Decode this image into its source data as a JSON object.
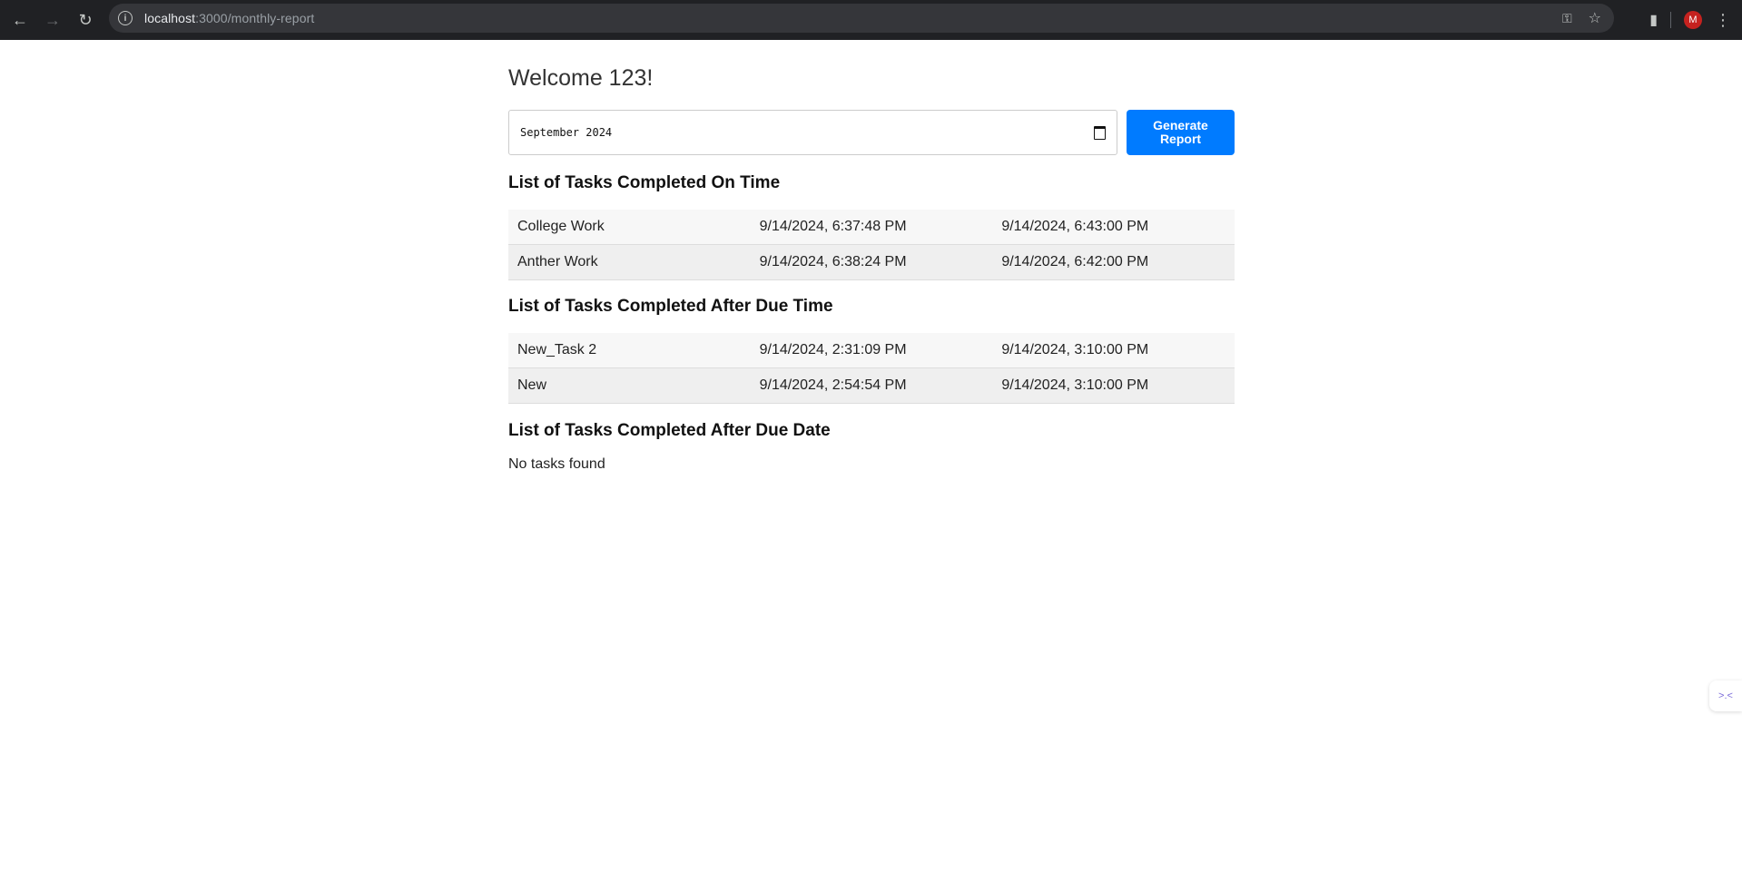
{
  "browser": {
    "url_host": "localhost",
    "url_path": ":3000/monthly-report",
    "avatar_letter": "M"
  },
  "page": {
    "welcome": "Welcome 123!",
    "month_value": "September 2024",
    "generate_label": "Generate Report"
  },
  "sections": [
    {
      "title": "List of Tasks Completed On Time",
      "rows": [
        [
          "College Work",
          "9/14/2024, 6:37:48 PM",
          "9/14/2024, 6:43:00 PM"
        ],
        [
          "Anther Work",
          "9/14/2024, 6:38:24 PM",
          "9/14/2024, 6:42:00 PM"
        ]
      ]
    },
    {
      "title": "List of Tasks Completed After Due Time",
      "rows": [
        [
          "New_Task 2",
          "9/14/2024, 2:31:09 PM",
          "9/14/2024, 3:10:00 PM"
        ],
        [
          "New",
          "9/14/2024, 2:54:54 PM",
          "9/14/2024, 3:10:00 PM"
        ]
      ]
    },
    {
      "title": "List of Tasks Completed After Due Date",
      "empty_text": "No tasks found"
    }
  ],
  "colors": {
    "primary_button": "#007bff",
    "chrome_bg": "#202124"
  }
}
